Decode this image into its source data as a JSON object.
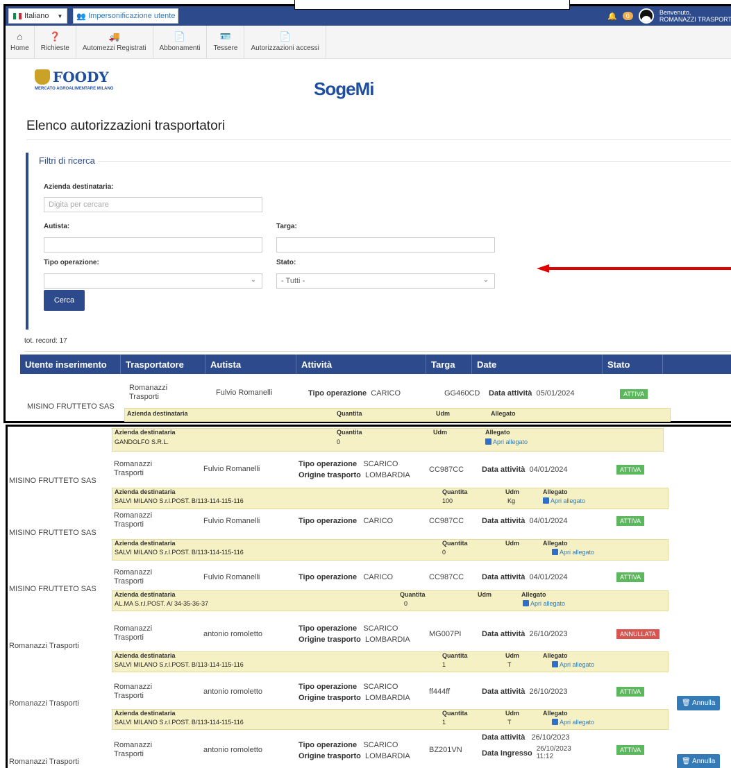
{
  "topbar": {
    "language": "Italiano",
    "impersonation": "Impersonificazione utente",
    "notifications_count": "0",
    "welcome_line1": "Benvenuto,",
    "welcome_line2": "ROMANAZZI TRASPORT"
  },
  "nav": [
    {
      "label": "Home",
      "icon": "home-icon"
    },
    {
      "label": "Richieste",
      "icon": "question-icon"
    },
    {
      "label": "Automezzi Registrati",
      "icon": "truck-icon"
    },
    {
      "label": "Abbonamenti",
      "icon": "document-icon"
    },
    {
      "label": "Tessere",
      "icon": "card-icon"
    },
    {
      "label": "Autorizzazioni accessi",
      "icon": "document-icon"
    }
  ],
  "logos": {
    "foody_name": "FOODY",
    "foody_sub": "MERCATO AGROALIMENTARE MILANO",
    "sogemi": "SogeMi"
  },
  "page_title": "Elenco autorizzazioni trasportatori",
  "filters": {
    "legend": "Filtri di ricerca",
    "azienda_label": "Azienda destinataria:",
    "azienda_placeholder": "Digita per cercare",
    "autista_label": "Autista:",
    "targa_label": "Targa:",
    "tipo_label": "Tipo operazione:",
    "stato_label": "Stato:",
    "stato_value": "- Tutti -",
    "search_button": "Cerca"
  },
  "tot_record": "tot. record: 17",
  "table": {
    "headers": [
      "Utente inserimento",
      "Trasportatore",
      "Autista",
      "Attività",
      "Targa",
      "Date",
      "Stato"
    ],
    "sub_headers": {
      "azienda": "Azienda destinataria",
      "quantita": "Quantita",
      "udm": "Udm",
      "allegato": "Allegato"
    },
    "labels": {
      "tipo": "Tipo operazione",
      "origine": "Origine trasporto",
      "data_attivita": "Data attività",
      "data_ingresso": "Data Ingresso"
    },
    "open_attachment": "Apri allegato",
    "annulla": "Annulla"
  },
  "records": [
    {
      "utente": "MISINO FRUTTETO SAS",
      "trasportatore_1": "Romanazzi",
      "trasportatore_2": "Trasporti",
      "autista": "Fulvio Romanelli",
      "tipo": "CARICO",
      "origine": "",
      "targa": "GG460CD",
      "data": "05/01/2024",
      "stato": "ATTIVA",
      "azienda": "GANDOLFO S.R.L.",
      "quantita": "0",
      "udm": ""
    },
    {
      "utente": "MISINO FRUTTETO SAS",
      "trasportatore_1": "Romanazzi",
      "trasportatore_2": "Trasporti",
      "autista": "Fulvio Romanelli",
      "tipo": "SCARICO",
      "origine": "LOMBARDIA",
      "targa": "CC987CC",
      "data": "04/01/2024",
      "stato": "ATTIVA",
      "azienda": "SALVI MILANO S.r.l.POST. B/113-114-115-116",
      "quantita": "100",
      "udm": "Kg"
    },
    {
      "utente": "MISINO FRUTTETO SAS",
      "trasportatore_1": "Romanazzi",
      "trasportatore_2": "Trasporti",
      "autista": "Fulvio Romanelli",
      "tipo": "CARICO",
      "origine": "",
      "targa": "CC987CC",
      "data": "04/01/2024",
      "stato": "ATTIVA",
      "azienda": "SALVI MILANO S.r.l.POST. B/113-114-115-116",
      "quantita": "0",
      "udm": ""
    },
    {
      "utente": "MISINO FRUTTETO SAS",
      "trasportatore_1": "Romanazzi",
      "trasportatore_2": "Trasporti",
      "autista": "Fulvio Romanelli",
      "tipo": "CARICO",
      "origine": "",
      "targa": "CC987CC",
      "data": "04/01/2024",
      "stato": "ATTIVA",
      "azienda": "AL.MA S.r.l.POST. A/ 34-35-36-37",
      "quantita": "0",
      "udm": ""
    },
    {
      "utente": "Romanazzi Trasporti",
      "trasportatore_1": "Romanazzi",
      "trasportatore_2": "Trasporti",
      "autista": "antonio romoletto",
      "tipo": "SCARICO",
      "origine": "LOMBARDIA",
      "targa": "MG007PI",
      "data": "26/10/2023",
      "stato": "ANNULLATA",
      "azienda": "SALVI MILANO S.r.l.POST. B/113-114-115-116",
      "quantita": "1",
      "udm": "T"
    },
    {
      "utente": "Romanazzi Trasporti",
      "trasportatore_1": "Romanazzi",
      "trasportatore_2": "Trasporti",
      "autista": "antonio romoletto",
      "tipo": "SCARICO",
      "origine": "LOMBARDIA",
      "targa": "ff444ff",
      "data": "26/10/2023",
      "stato": "ATTIVA",
      "azienda": "SALVI MILANO S.r.l.POST. B/113-114-115-116",
      "quantita": "1",
      "udm": "T"
    },
    {
      "utente": "Romanazzi Trasporti",
      "trasportatore_1": "Romanazzi",
      "trasportatore_2": "Trasporti",
      "autista": "antonio romoletto",
      "tipo": "SCARICO",
      "origine": "LOMBARDIA",
      "targa": "BZ201VN",
      "data": "26/10/2023",
      "data_ingresso_1": "26/10/2023",
      "data_ingresso_2": "11:12",
      "stato": "ATTIVA"
    }
  ],
  "colors": {
    "primary": "#2c4a8c",
    "attiva": "#5cb85c",
    "annullata": "#d9534f",
    "subrow": "#f6f1c4",
    "arrow": "#e00000"
  }
}
